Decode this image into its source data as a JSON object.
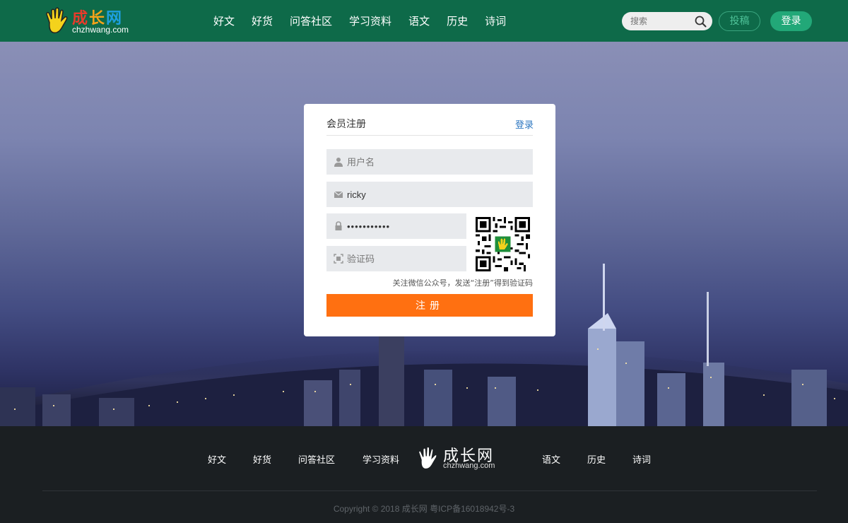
{
  "header": {
    "logo": {
      "cn_1": "成",
      "cn_2": "长",
      "cn_3": "网",
      "en": "chzhwang.com"
    },
    "nav": [
      "好文",
      "好货",
      "问答社区",
      "学习资料",
      "语文",
      "历史",
      "诗词"
    ],
    "search": {
      "placeholder": "搜索"
    },
    "post_label": "投稿",
    "login_label": "登录"
  },
  "register": {
    "title": "会员注册",
    "login_link": "登录",
    "username": {
      "placeholder": "用户名",
      "value": ""
    },
    "email": {
      "value": "ricky"
    },
    "password": {
      "value": "•••••••••••"
    },
    "captcha": {
      "placeholder": "验证码"
    },
    "hint": "关注微信公众号，发送“注册”得到验证码",
    "submit_label": "注册"
  },
  "footer": {
    "nav": [
      "好文",
      "好货",
      "问答社区",
      "学习资料",
      "语文",
      "历史",
      "诗词"
    ],
    "logo": {
      "cn": "成长网",
      "en": "chzhwang.com"
    },
    "copyright": "Copyright © 2018 成长网 粤ICP备16018942号-3"
  },
  "colors": {
    "header_bg": "#0e6a49",
    "accent_green": "#22a878",
    "submit_orange": "#ff7011",
    "footer_bg": "#1b1f22",
    "link_blue": "#2b76c0"
  }
}
